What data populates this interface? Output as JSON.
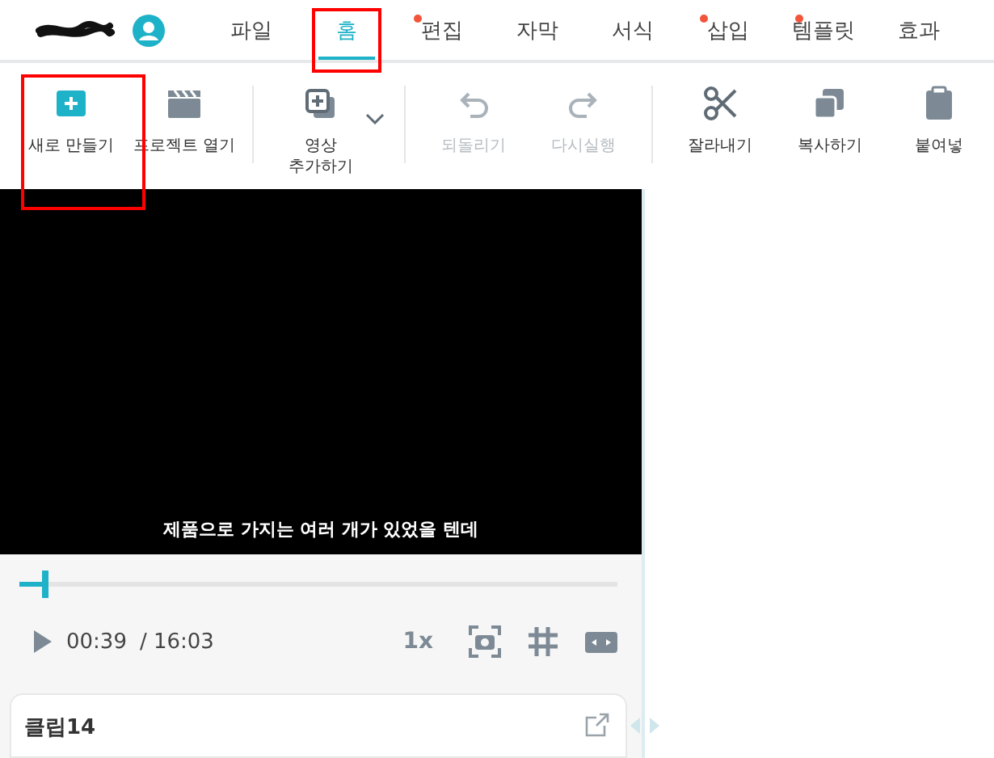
{
  "topbar": {
    "tabs": [
      {
        "label": "파일",
        "selected": false,
        "dot": false,
        "highlighted": false
      },
      {
        "label": "홈",
        "selected": true,
        "dot": false,
        "highlighted": true
      },
      {
        "label": "편집",
        "selected": false,
        "dot": true,
        "highlighted": false
      },
      {
        "label": "자막",
        "selected": false,
        "dot": false,
        "highlighted": false
      },
      {
        "label": "서식",
        "selected": false,
        "dot": false,
        "highlighted": false
      },
      {
        "label": "삽입",
        "selected": false,
        "dot": true,
        "highlighted": false
      },
      {
        "label": "템플릿",
        "selected": false,
        "dot": true,
        "highlighted": false
      },
      {
        "label": "효과",
        "selected": false,
        "dot": false,
        "highlighted": false
      }
    ]
  },
  "toolbar": [
    {
      "kind": "new",
      "label": "새로 만들기",
      "disabled": false,
      "highlighted": true
    },
    {
      "kind": "open",
      "label": "프로젝트 열기",
      "disabled": false,
      "highlighted": false
    },
    {
      "kind": "separator"
    },
    {
      "kind": "add-video",
      "label": "영상\n추가하기",
      "disabled": false,
      "highlighted": false
    },
    {
      "kind": "separator"
    },
    {
      "kind": "undo",
      "label": "되돌리기",
      "disabled": true,
      "highlighted": false
    },
    {
      "kind": "redo",
      "label": "다시실행",
      "disabled": true,
      "highlighted": false
    },
    {
      "kind": "separator"
    },
    {
      "kind": "cut",
      "label": "잘라내기",
      "disabled": false,
      "highlighted": false
    },
    {
      "kind": "copy",
      "label": "복사하기",
      "disabled": false,
      "highlighted": false
    },
    {
      "kind": "paste",
      "label": "붙여넣",
      "disabled": false,
      "highlighted": false
    }
  ],
  "player": {
    "subtitle": "제품으로 가지는 여러 개가 있었을 텐데",
    "level": 0.043,
    "current_time": "00:39",
    "total_time": "/ 16:03",
    "speed": "1x"
  },
  "clip": {
    "title": "클립14"
  }
}
